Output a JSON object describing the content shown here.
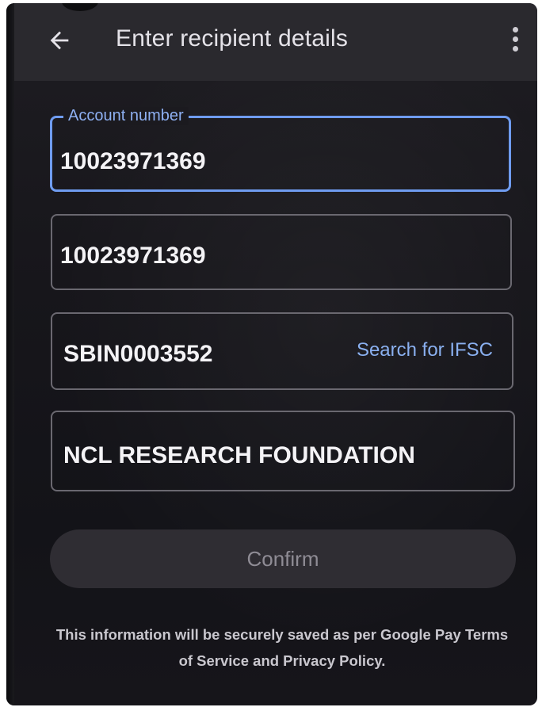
{
  "app_bar": {
    "title": "Enter recipient details",
    "back_icon": "arrow-left-icon",
    "menu_icon": "more-vert-icon"
  },
  "form": {
    "account_number": {
      "label": "Account number",
      "value": "10023971369"
    },
    "confirm_account_number": {
      "value": "10023971369"
    },
    "ifsc": {
      "value": "SBIN0003552",
      "link_label": "Search for IFSC"
    },
    "recipient_name": {
      "value": "NCL RESEARCH FOUNDATION"
    }
  },
  "confirm_button": {
    "label": "Confirm"
  },
  "disclaimer": {
    "line1": "This information will be securely saved as per Google Pay Terms",
    "line2": "of Service and Privacy Policy."
  },
  "colors": {
    "background": "#17161b",
    "app_bar": "#2a292e",
    "accent": "#8ab0f0",
    "focused_border": "#6f9cf0",
    "button_bg": "#2f2d33"
  }
}
